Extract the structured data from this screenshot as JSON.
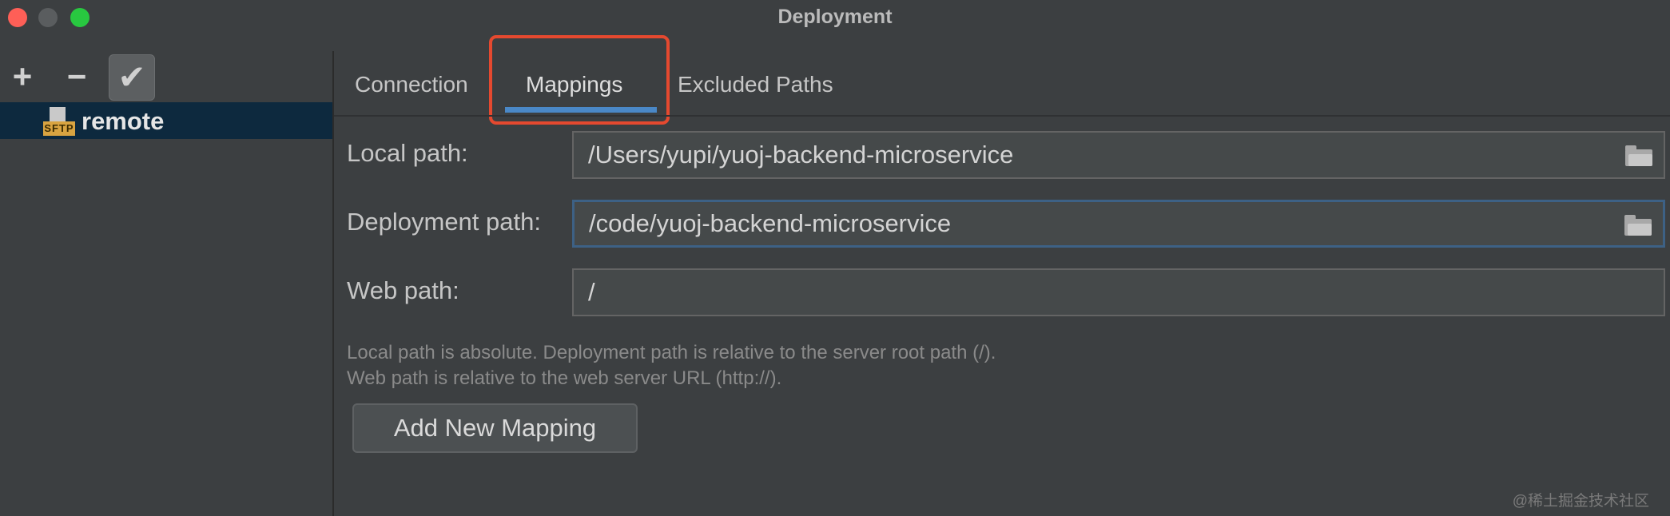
{
  "window": {
    "title": "Deployment"
  },
  "sidebar": {
    "toolbar": {
      "add_label": "+",
      "remove_label": "−",
      "apply_label": "✔"
    },
    "items": [
      {
        "icon_label": "SFTP",
        "label": "remote"
      }
    ]
  },
  "tabs": [
    {
      "label": "Connection"
    },
    {
      "label": "Mappings",
      "selected": true
    },
    {
      "label": "Excluded Paths"
    }
  ],
  "mappings": {
    "local_path": {
      "label": "Local path:",
      "value": "/Users/yupi/yuoj-backend-microservice"
    },
    "deployment_path": {
      "label": "Deployment path:",
      "value": "/code/yuoj-backend-microservice"
    },
    "web_path": {
      "label": "Web path:",
      "value": "/"
    },
    "hint_line1": "Local path is absolute. Deployment path is relative to the server root path (/).",
    "hint_line2": "Web path is relative to the web server URL (http://).",
    "add_button_label": "Add New Mapping"
  },
  "watermark": "@稀土掘金技术社区",
  "colors": {
    "accent": "#4a88c7",
    "highlight_box": "#e5492f",
    "selection": "#0d293e"
  }
}
